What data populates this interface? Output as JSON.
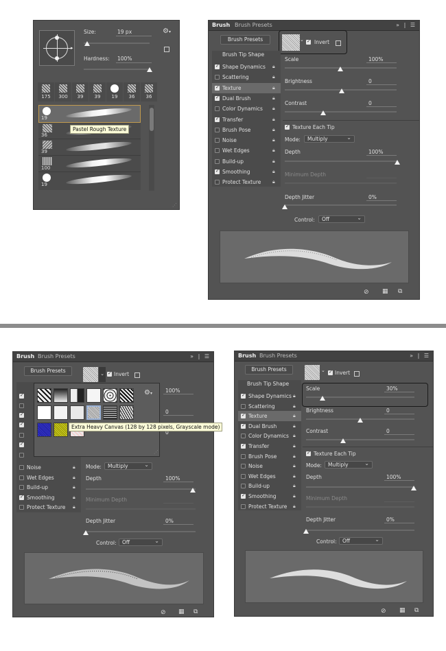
{
  "brush_tip_picker": {
    "size_label": "Size:",
    "size_value": "19 px",
    "hardness_label": "Hardness:",
    "hardness_value": "100%",
    "size_level": 0.05,
    "hardness_level": 1.0,
    "recent_sizes": [
      "175",
      "300",
      "39",
      "39",
      "19",
      "36",
      "36"
    ],
    "list_sizes": [
      "19",
      "36",
      "39",
      "100",
      "19"
    ],
    "tooltip": "Pastel Rough Texture"
  },
  "top_panel": {
    "tabs": [
      "Brush",
      "Brush Presets"
    ],
    "presets_button": "Brush Presets",
    "invert_label": "Invert",
    "sidebar_header": "Brush Tip Shape",
    "sidebar": [
      {
        "label": "Shape Dynamics",
        "checked": true
      },
      {
        "label": "Scattering",
        "checked": false
      },
      {
        "label": "Texture",
        "checked": true,
        "selected": true
      },
      {
        "label": "Dual Brush",
        "checked": true
      },
      {
        "label": "Color Dynamics",
        "checked": false
      },
      {
        "label": "Transfer",
        "checked": true
      },
      {
        "label": "Brush Pose",
        "checked": false
      },
      {
        "label": "Noise",
        "checked": false
      },
      {
        "label": "Wet Edges",
        "checked": false
      },
      {
        "label": "Build-up",
        "checked": false
      },
      {
        "label": "Smoothing",
        "checked": true
      },
      {
        "label": "Protect Texture",
        "checked": false
      }
    ],
    "scale_label": "Scale",
    "scale_value": "100%",
    "brightness_label": "Brightness",
    "brightness_value": "0",
    "contrast_label": "Contrast",
    "contrast_value": "0",
    "texture_each_tip": "Texture Each Tip",
    "mode_label": "Mode:",
    "mode_value": "Multiply",
    "depth_label": "Depth",
    "depth_value": "100%",
    "min_depth_label": "Minimum Depth",
    "depth_jitter_label": "Depth Jitter",
    "depth_jitter_value": "0%",
    "control_label": "Control:",
    "control_value": "Off"
  },
  "bottom_left": {
    "tabs": [
      "Brush",
      "Brush Presets"
    ],
    "presets_button": "Brush Presets",
    "invert_label": "Invert",
    "sidebar": [
      {
        "label": "Noise",
        "checked": false
      },
      {
        "label": "Wet Edges",
        "checked": false
      },
      {
        "label": "Build-up",
        "checked": false
      },
      {
        "label": "Smoothing",
        "checked": true
      },
      {
        "label": "Protect Texture",
        "checked": false
      }
    ],
    "scale_value": "100%",
    "brightness_value": "0",
    "contrast_value": "0",
    "mode_label": "Mode:",
    "mode_value": "Multiply",
    "depth_label": "Depth",
    "depth_value": "100%",
    "min_depth_label": "Minimum Depth",
    "depth_jitter_label": "Depth Jitter",
    "depth_jitter_value": "0%",
    "control_label": "Control:",
    "control_value": "Off",
    "tooltip": "Extra Heavy Canvas (128 by 128 pixels, Grayscale mode)"
  },
  "bottom_right": {
    "tabs": [
      "Brush",
      "Brush Presets"
    ],
    "presets_button": "Brush Presets",
    "invert_label": "Invert",
    "sidebar_header": "Brush Tip Shape",
    "sidebar": [
      {
        "label": "Shape Dynamics",
        "checked": true
      },
      {
        "label": "Scattering",
        "checked": false
      },
      {
        "label": "Texture",
        "checked": true,
        "selected": true
      },
      {
        "label": "Dual Brush",
        "checked": true
      },
      {
        "label": "Color Dynamics",
        "checked": false
      },
      {
        "label": "Transfer",
        "checked": true
      },
      {
        "label": "Brush Pose",
        "checked": false
      },
      {
        "label": "Noise",
        "checked": false
      },
      {
        "label": "Wet Edges",
        "checked": false
      },
      {
        "label": "Build-up",
        "checked": false
      },
      {
        "label": "Smoothing",
        "checked": true
      },
      {
        "label": "Protect Texture",
        "checked": false
      }
    ],
    "scale_label": "Scale",
    "scale_value": "30%",
    "brightness_label": "Brightness",
    "brightness_value": "0",
    "contrast_label": "Contrast",
    "contrast_value": "0",
    "texture_each_tip": "Texture Each Tip",
    "mode_label": "Mode:",
    "mode_value": "Multiply",
    "depth_label": "Depth",
    "depth_value": "100%",
    "min_depth_label": "Minimum Depth",
    "depth_jitter_label": "Depth Jitter",
    "depth_jitter_value": "0%",
    "control_label": "Control:",
    "control_value": "Off"
  }
}
